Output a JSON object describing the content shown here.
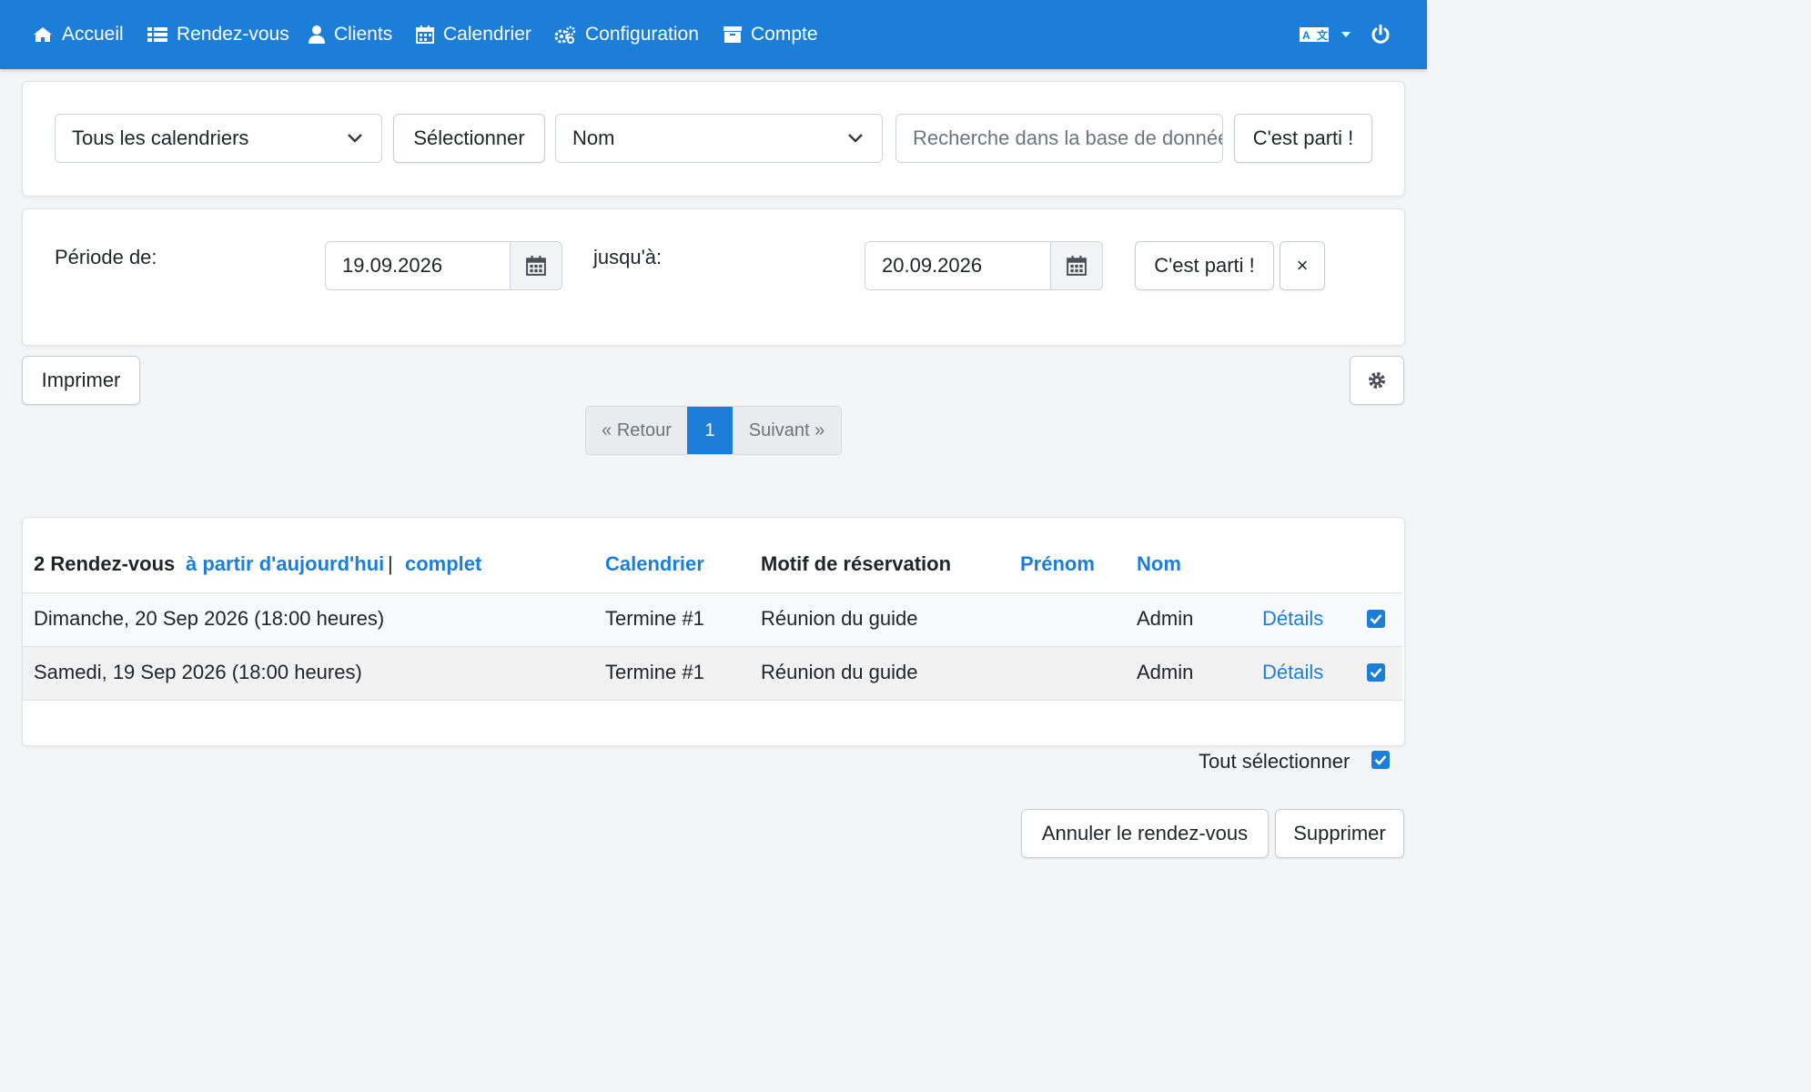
{
  "nav": {
    "home": "Accueil",
    "appointments": "Rendez-vous",
    "clients": "Clients",
    "calendar": "Calendrier",
    "configuration": "Configuration",
    "account": "Compte"
  },
  "search": {
    "calendar_select": "Tous les calendriers",
    "select_button": "Sélectionner",
    "field_select": "Nom",
    "search_placeholder": "Recherche dans la base de données",
    "go_button": "C'est parti !"
  },
  "period": {
    "from_label": "Période de:",
    "from_value": "19.09.2026",
    "to_label": "jusqu'à:",
    "to_value": "20.09.2026",
    "go_button": "C'est parti !",
    "clear_button": "×"
  },
  "toolbar": {
    "print_button": "Imprimer"
  },
  "pagination": {
    "prev": "« Retour",
    "current": "1",
    "next": "Suivant »"
  },
  "table": {
    "count_label": "2 Rendez-vous",
    "from_today_link": "à partir d'aujourd'hui",
    "separator": "|",
    "complete_link": "complet",
    "headers": {
      "calendar": "Calendrier",
      "reason": "Motif de réservation",
      "firstname": "Prénom",
      "lastname": "Nom"
    },
    "rows": [
      {
        "date": "Dimanche, 20 Sep 2026 (18:00 heures)",
        "calendar": "Termine #1",
        "reason": "Réunion du guide",
        "firstname": "",
        "lastname": "Admin",
        "details": "Détails",
        "checked": true
      },
      {
        "date": "Samedi, 19 Sep 2026 (18:00 heures)",
        "calendar": "Termine #1",
        "reason": "Réunion du guide",
        "firstname": "",
        "lastname": "Admin",
        "details": "Détails",
        "checked": true
      }
    ]
  },
  "footer": {
    "select_all_label": "Tout sélectionner",
    "select_all_checked": true,
    "cancel_button": "Annuler le rendez-vous",
    "delete_button": "Supprimer"
  },
  "colors": {
    "accent": "#1c7ed6",
    "navbar": "#1c7ed6"
  }
}
